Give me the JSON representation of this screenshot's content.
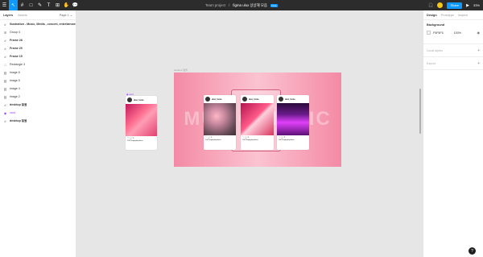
{
  "toolbar": {
    "tools": [
      {
        "name": "main-menu",
        "glyph": "☰"
      },
      {
        "name": "move-tool",
        "glyph": "↖"
      },
      {
        "name": "frame-tool",
        "glyph": "#"
      },
      {
        "name": "shape-tool",
        "glyph": "□"
      },
      {
        "name": "pen-tool",
        "glyph": "✎"
      },
      {
        "name": "text-tool",
        "glyph": "T"
      },
      {
        "name": "resources-tool",
        "glyph": "⊞"
      },
      {
        "name": "hand-tool",
        "glyph": "✋"
      },
      {
        "name": "comment-tool",
        "glyph": "💬"
      }
    ],
    "project": "Team project",
    "separator": "/",
    "file_name": "figma ulux 상상해 모음",
    "badge": "Free",
    "share_label": "Share",
    "zoom": "33%"
  },
  "left_panel": {
    "tab_layers": "Layers",
    "tab_assets": "Assets",
    "page_label": "Page 1 ⌄",
    "layers": [
      {
        "icon": "#",
        "name": "Illustration - Music, Media , concert, entertainment...",
        "bold": true
      },
      {
        "icon": "⊞",
        "name": "Group 4",
        "bold": false
      },
      {
        "icon": "#",
        "name": "Frame 28",
        "bold": true
      },
      {
        "icon": "#",
        "name": "Frame 29",
        "bold": true
      },
      {
        "icon": "#",
        "name": "Frame 15",
        "bold": true
      },
      {
        "icon": "□",
        "name": "Rectangle 3",
        "bold": false
      },
      {
        "icon": "▨",
        "name": "image 6",
        "bold": false
      },
      {
        "icon": "▨",
        "name": "image 5",
        "bold": false
      },
      {
        "icon": "▨",
        "name": "image 4",
        "bold": false
      },
      {
        "icon": "▨",
        "name": "image 2",
        "bold": false
      },
      {
        "icon": "#",
        "name": "desktop 일을",
        "bold": true
      },
      {
        "icon": "◆",
        "name": "card",
        "bold": false,
        "purple": true
      },
      {
        "icon": "#",
        "name": "desktop 일을",
        "bold": true
      }
    ]
  },
  "right_panel": {
    "tab_design": "Design",
    "tab_prototype": "Prototype",
    "tab_inspect": "Inspect",
    "background_title": "Background",
    "background_hex": "F5F5F5",
    "background_opacity": "100%",
    "local_styles": "Local styles",
    "export": "Export"
  },
  "canvas": {
    "desktop_label": "desktop 일을",
    "mobile_label": "◆ card",
    "big_text": "MUSIC MUSIC",
    "cards": [
      {
        "user": "ulux_home",
        "caption": "100 Singleplayilemo"
      },
      {
        "user": "ulux_home",
        "caption": "100 Singleplayilemo"
      },
      {
        "user": "ulux_home",
        "caption": "100 Singleplayilemo"
      },
      {
        "user": "ulux_home",
        "caption": "100 Singleplayilemo"
      }
    ],
    "card_icons": "♡ ◯ ✈"
  },
  "help": "?"
}
